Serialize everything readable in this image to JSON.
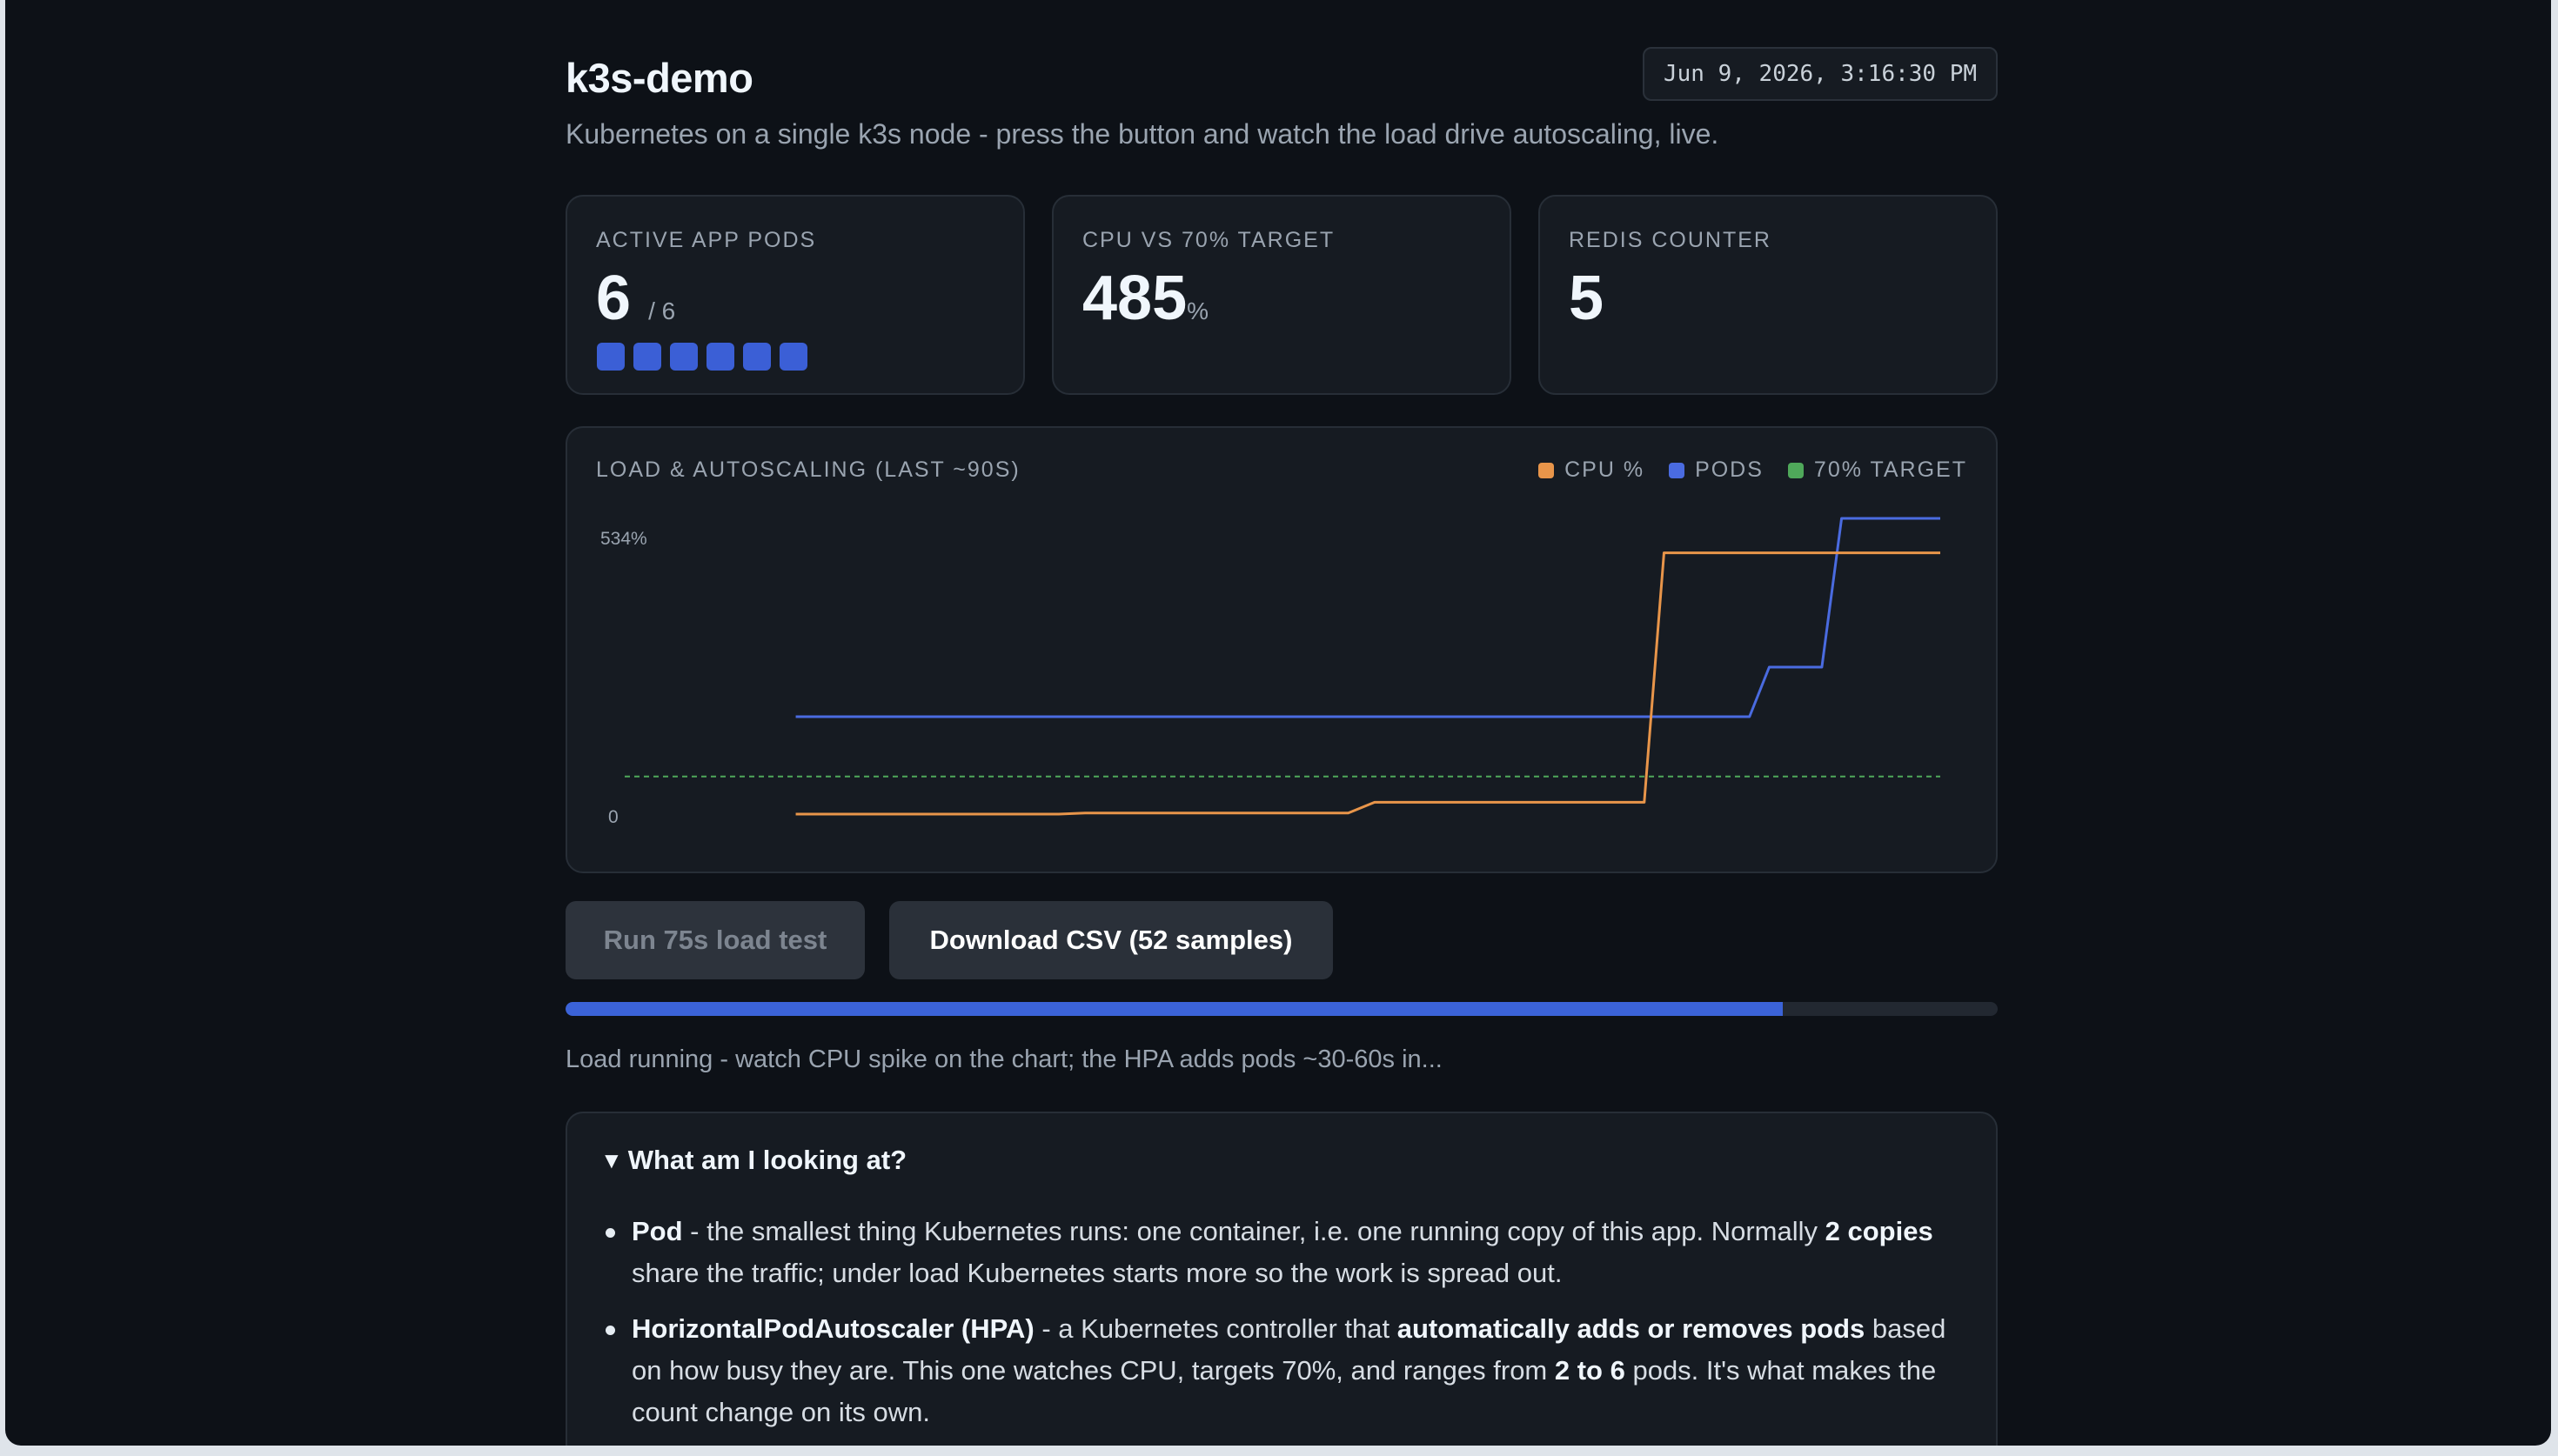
{
  "header": {
    "title": "k3s-demo",
    "clock": "Jun 9, 2026, 3:16:30 PM",
    "subtitle": "Kubernetes on a single k3s node - press the button and watch the load drive autoscaling, live."
  },
  "stats": {
    "pods": {
      "label": "ACTIVE APP PODS",
      "value": "6",
      "suffix": "/ 6",
      "count": 6
    },
    "cpu": {
      "label": "CPU VS 70% TARGET",
      "value": "485",
      "suffix": "%"
    },
    "redis": {
      "label": "REDIS COUNTER",
      "value": "5"
    }
  },
  "chart": {
    "title": "LOAD & AUTOSCALING (LAST ~90S)",
    "legend": [
      "CPU %",
      "PODS",
      "70% TARGET"
    ],
    "y_max_label": "534%",
    "y_min_label": "0"
  },
  "chart_data": {
    "type": "line",
    "ylim": [
      0,
      534
    ],
    "series": [
      {
        "name": "CPU %",
        "color": "#e8954a",
        "points": [
          [
            0.13,
            0
          ],
          [
            0.33,
            0
          ],
          [
            0.35,
            2
          ],
          [
            0.55,
            2
          ],
          [
            0.57,
            22
          ],
          [
            0.775,
            22
          ],
          [
            0.79,
            486
          ],
          [
            1,
            486
          ]
        ]
      },
      {
        "name": "PODS",
        "color": "#4a6be0",
        "points": [
          [
            0.13,
            2
          ],
          [
            0.855,
            2
          ],
          [
            0.87,
            3
          ],
          [
            0.91,
            3
          ],
          [
            0.925,
            6
          ],
          [
            1,
            6
          ]
        ]
      },
      {
        "name": "70% TARGET",
        "color": "#4fa85a",
        "value": 70
      }
    ],
    "pods_axis_max": 6
  },
  "actions": {
    "run_label": "Run 75s load test",
    "csv_label": "Download CSV (52 samples)"
  },
  "progress": {
    "fraction": 0.85
  },
  "status": "Load running - watch CPU spike on the chart; the HPA adds pods ~30-60s in...",
  "details": {
    "summary": "What am I looking at?",
    "items": [
      {
        "term": "Pod",
        "p1": " - the smallest thing Kubernetes runs: one container, i.e. one running copy of this app. Normally ",
        "b1": "2 copies",
        "p2": " share the traffic; under load Kubernetes starts more so the work is spread out."
      },
      {
        "term": "HorizontalPodAutoscaler (HPA)",
        "p1": " - a Kubernetes controller that ",
        "b1": "automatically adds or removes pods",
        "p2": " based on how busy they are. This one watches CPU, targets 70%, and ranges from ",
        "b2": "2 to 6",
        "p3": " pods. It's what makes the count change on its own."
      }
    ]
  },
  "colors": {
    "accent": "#3b63d8",
    "cpu": "#e8954a",
    "pods": "#4a6be0",
    "target": "#4fa85a"
  }
}
